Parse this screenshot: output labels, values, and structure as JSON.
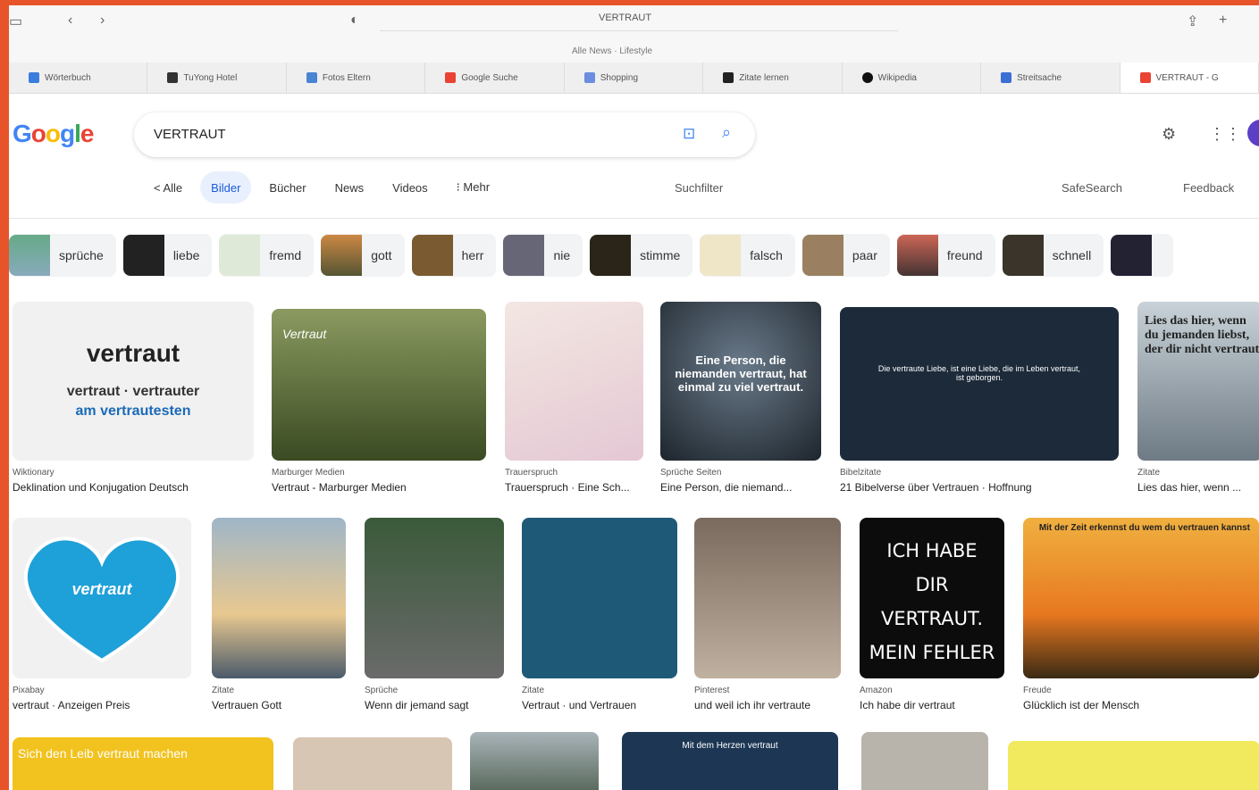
{
  "browser": {
    "address": "VERTRAUT",
    "subline": "Alle News · Lifestyle",
    "tabs": [
      "Wörterbuch",
      "TuYong Hotel",
      "Fotos Eltern",
      "Google Suche",
      "Shopping",
      "Zitate lernen",
      "Wikipedia",
      "Streitsache",
      "VERTRAUT - G"
    ]
  },
  "google": {
    "logo": "Google",
    "query": "VERTRAUT",
    "filters": [
      "< Alle",
      "Bilder",
      "Bücher",
      "News",
      "Videos",
      "⁝ Mehr"
    ],
    "tools": "Suchfilter",
    "safe": "SafeSearch",
    "feedback": "Feedback"
  },
  "related": [
    "sprüche",
    "liebe",
    "fremd",
    "gott",
    "herr",
    "nie",
    "stimme",
    "falsch",
    "paar",
    "freund",
    "schnell"
  ],
  "row1": [
    {
      "source": "Wiktionary",
      "caption": "Deklination und Konjugation Deutsch",
      "word": "vertraut",
      "forms": "vertraut · vertrauter",
      "superlative": "am vertrautesten"
    },
    {
      "source": "Marburger Medien",
      "caption": "Vertraut - Marburger Medien",
      "overlay": "Vertraut"
    },
    {
      "source": "Trauerspruch",
      "caption": "Trauerspruch · Eine Sch...",
      "overlay": ""
    },
    {
      "source": "Sprüche Seiten",
      "caption": "Eine Person, die niemand...",
      "overlay": "Eine Person, die niemanden vertraut, hat einmal zu viel vertraut."
    },
    {
      "source": "Bibelzitate",
      "caption": "21 Bibelverse über Vertrauen · Hoffnung",
      "overlay": "Die vertraute Liebe, ist eine Liebe, die im Leben vertraut, ist geborgen."
    },
    {
      "source": "Zitate",
      "caption": "Lies das hier, wenn ...",
      "overlay": "Lies das hier, wenn du jemanden liebst, der dir nicht vertraut"
    }
  ],
  "row2": [
    {
      "source": "Pixabay",
      "caption": "vertraut · Anzeigen Preis",
      "overlay": "vertraut"
    },
    {
      "source": "Zitate",
      "caption": "Vertrauen Gott",
      "overlay": ""
    },
    {
      "source": "Sprüche",
      "caption": "Wenn dir jemand sagt",
      "overlay": ""
    },
    {
      "source": "Zitate",
      "caption": "Vertraut · und Vertrauen",
      "overlay": ""
    },
    {
      "source": "Pinterest",
      "caption": "und weil ich ihr vertraute",
      "overlay": ""
    },
    {
      "source": "Amazon",
      "caption": "Ich habe dir vertraut",
      "overlay": "ICH HABE DIR VERTRAUT. MEIN FEHLER"
    },
    {
      "source": "Freude",
      "caption": "Glücklich ist der Mensch",
      "overlay": "Mit der Zeit erkennst du wem du vertrauen kannst"
    }
  ],
  "row3": [
    {
      "overlay": "Sich den Leib vertraut machen"
    },
    {
      "overlay": ""
    },
    {
      "overlay": ""
    },
    {
      "overlay": "Mit dem Herzen vertraut"
    },
    {
      "overlay": ""
    },
    {
      "overlay": ""
    }
  ]
}
